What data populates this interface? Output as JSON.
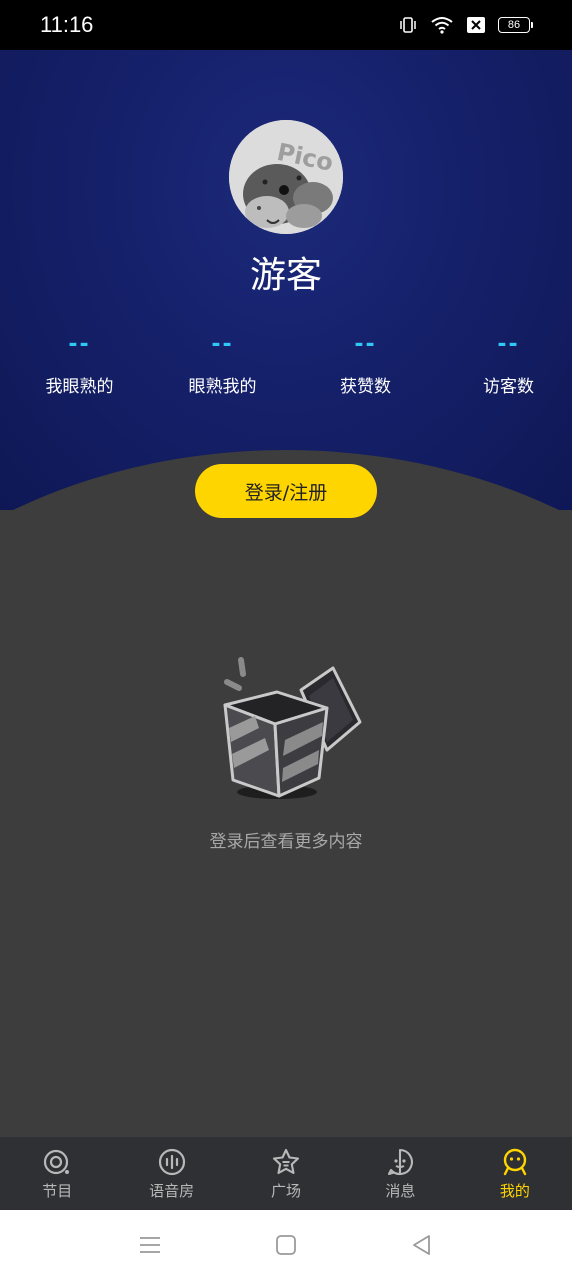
{
  "status_bar": {
    "time": "11:16",
    "battery": "86",
    "icons": [
      "vibrate-icon",
      "wifi-icon",
      "sim-off-icon",
      "battery-icon"
    ]
  },
  "profile": {
    "avatar_text": "Pico",
    "name": "游客"
  },
  "stats": [
    {
      "value": "--",
      "label": "我眼熟的"
    },
    {
      "value": "--",
      "label": "眼熟我的"
    },
    {
      "value": "--",
      "label": "获赞数"
    },
    {
      "value": "--",
      "label": "访客数"
    }
  ],
  "login_button": "登录/注册",
  "empty_state": {
    "text": "登录后查看更多内容",
    "icon": "empty-box-icon"
  },
  "tabs": [
    {
      "label": "节目",
      "icon": "program-icon",
      "active": false
    },
    {
      "label": "语音房",
      "icon": "voice-room-icon",
      "active": false
    },
    {
      "label": "广场",
      "icon": "square-icon",
      "active": false
    },
    {
      "label": "消息",
      "icon": "message-icon",
      "active": false
    },
    {
      "label": "我的",
      "icon": "me-icon",
      "active": true
    }
  ],
  "colors": {
    "header_blue": "#15206a",
    "accent_yellow": "#ffd500",
    "stat_cyan": "#2ec9f5",
    "background": "#3d3d3d",
    "tabbar": "#2e3034"
  },
  "system_nav": [
    "menu-icon",
    "home-icon",
    "back-icon"
  ]
}
